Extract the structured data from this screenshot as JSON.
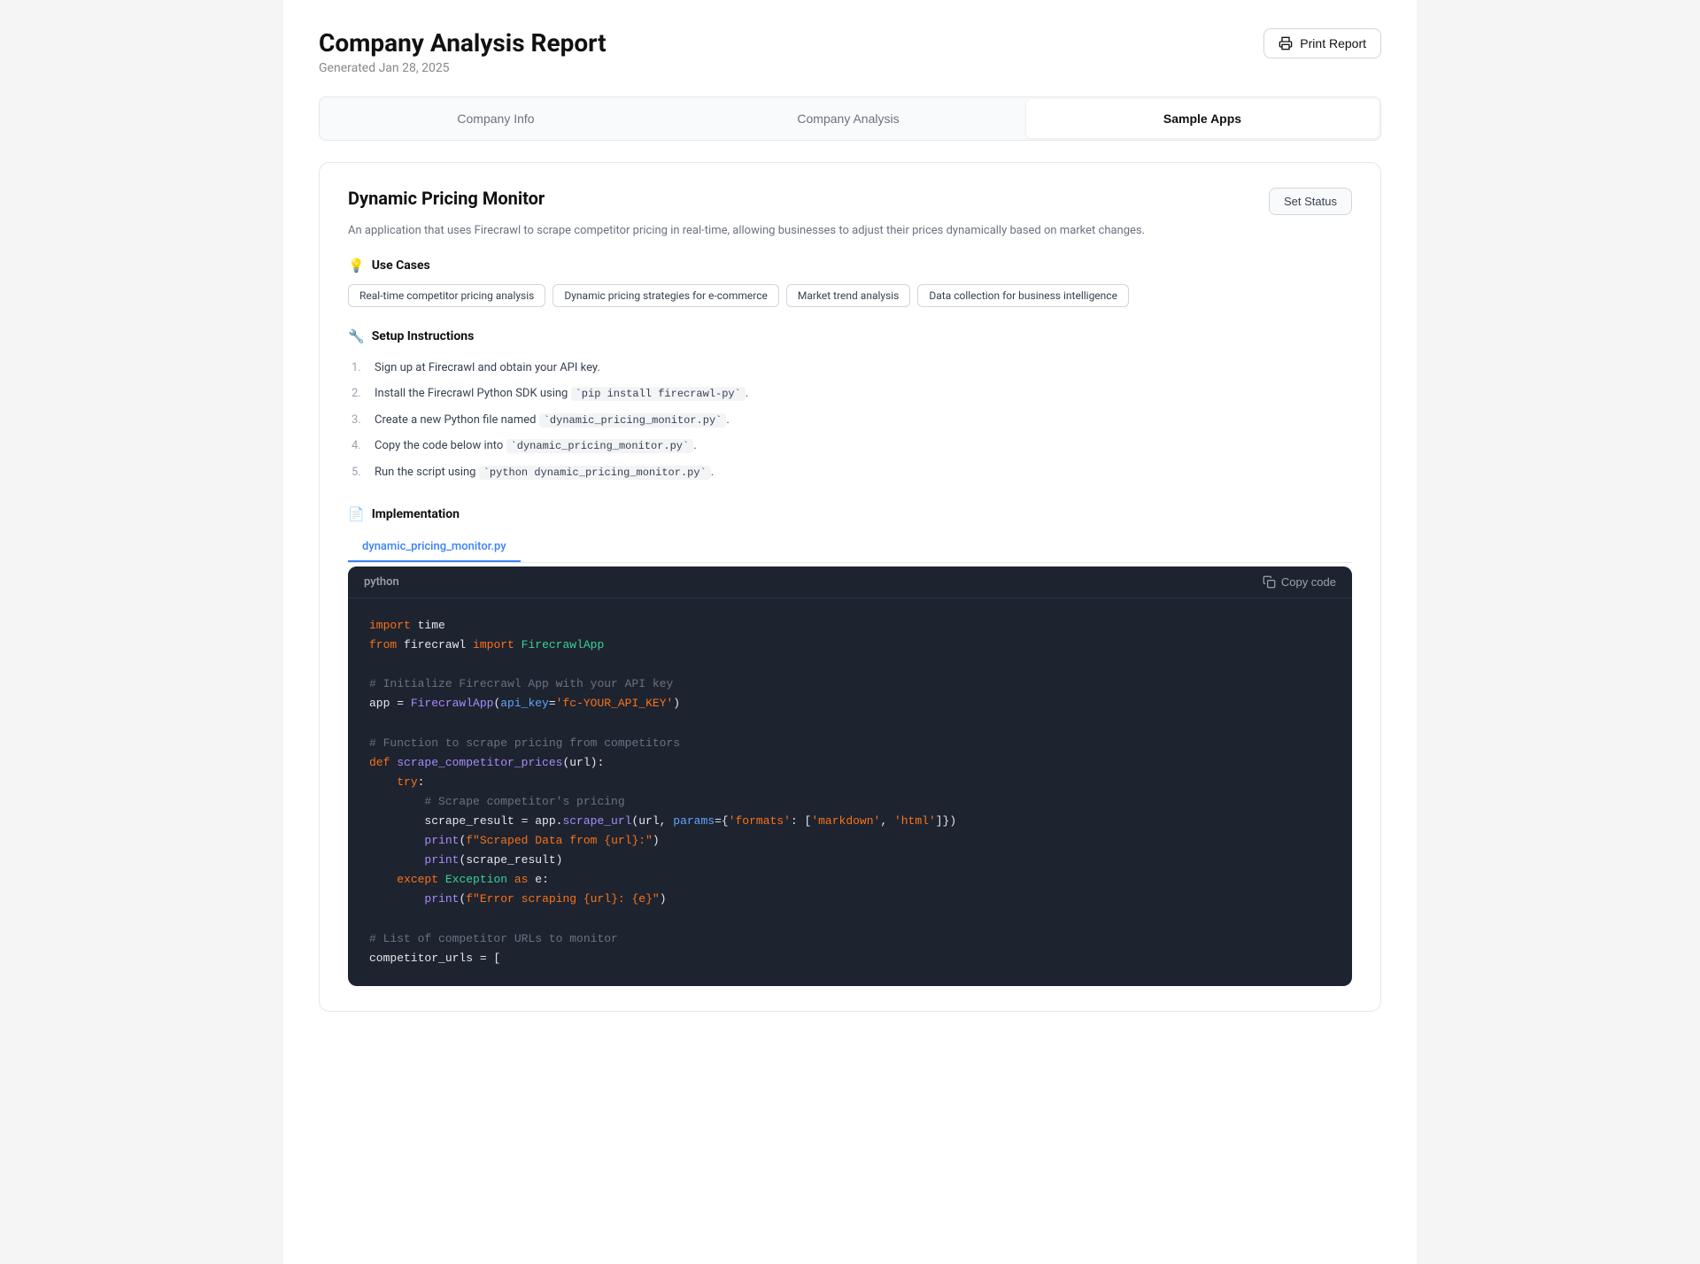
{
  "header": {
    "title": "Company Analysis Report",
    "generated": "Generated Jan 28, 2025",
    "print_label": "Print Report"
  },
  "tabs": [
    {
      "id": "company-info",
      "label": "Company Info",
      "active": false
    },
    {
      "id": "company-analysis",
      "label": "Company Analysis",
      "active": false
    },
    {
      "id": "sample-apps",
      "label": "Sample Apps",
      "active": true
    }
  ],
  "app": {
    "title": "Dynamic Pricing Monitor",
    "description": "An application that uses Firecrawl to scrape competitor pricing in real-time, allowing businesses to adjust their prices dynamically based on market changes.",
    "set_status_label": "Set Status",
    "use_cases_heading": "Use Cases",
    "use_cases": [
      "Real-time competitor pricing analysis",
      "Dynamic pricing strategies for e-commerce",
      "Market trend analysis",
      "Data collection for business intelligence"
    ],
    "setup_heading": "Setup Instructions",
    "setup_steps": [
      "Sign up at Firecrawl and obtain your API key.",
      "Install the Firecrawl Python SDK using `pip install firecrawl-py`.",
      "Create a new Python file named `dynamic_pricing_monitor.py`.",
      "Copy the code below into `dynamic_pricing_monitor.py`.",
      "Run the script using `python dynamic_pricing_monitor.py`."
    ],
    "impl_heading": "Implementation",
    "file_tab": "dynamic_pricing_monitor.py",
    "code_lang": "python",
    "copy_label": "Copy code"
  }
}
